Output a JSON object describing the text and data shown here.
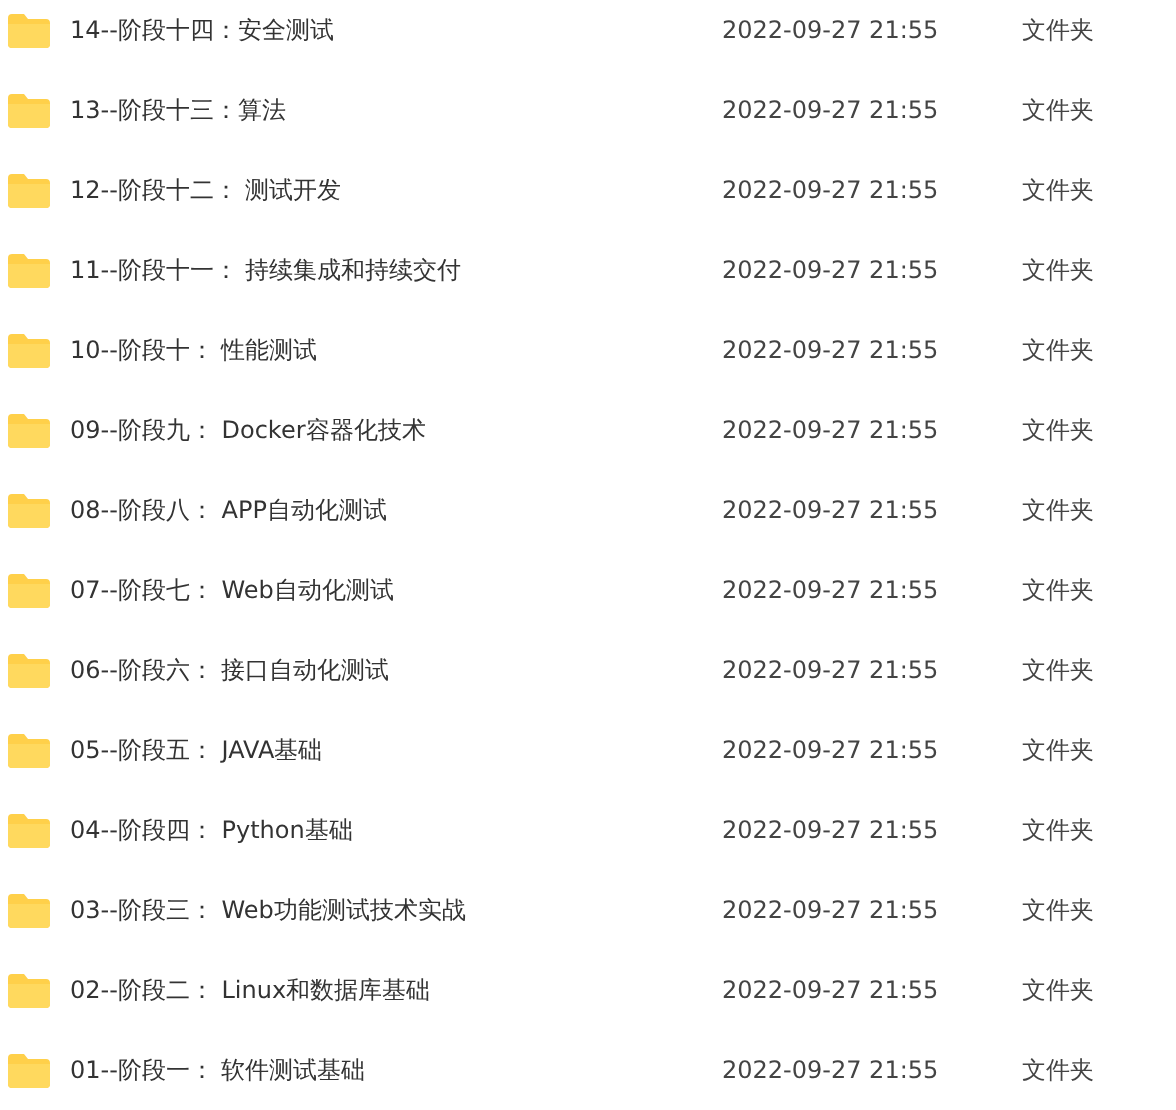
{
  "files": [
    {
      "name": "14--阶段十四：安全测试",
      "modified": "2022-09-27 21:55",
      "type": "文件夹"
    },
    {
      "name": "13--阶段十三：算法",
      "modified": "2022-09-27 21:55",
      "type": "文件夹"
    },
    {
      "name": "12--阶段十二： 测试开发",
      "modified": "2022-09-27 21:55",
      "type": "文件夹"
    },
    {
      "name": "11--阶段十一： 持续集成和持续交付",
      "modified": "2022-09-27 21:55",
      "type": "文件夹"
    },
    {
      "name": "10--阶段十： 性能测试",
      "modified": "2022-09-27 21:55",
      "type": "文件夹"
    },
    {
      "name": "09--阶段九： Docker容器化技术",
      "modified": "2022-09-27 21:55",
      "type": "文件夹"
    },
    {
      "name": "08--阶段八： APP自动化测试",
      "modified": "2022-09-27 21:55",
      "type": "文件夹"
    },
    {
      "name": "07--阶段七： Web自动化测试",
      "modified": "2022-09-27 21:55",
      "type": "文件夹"
    },
    {
      "name": "06--阶段六： 接口自动化测试",
      "modified": "2022-09-27 21:55",
      "type": "文件夹"
    },
    {
      "name": "05--阶段五： JAVA基础",
      "modified": "2022-09-27 21:55",
      "type": "文件夹"
    },
    {
      "name": "04--阶段四： Python基础",
      "modified": "2022-09-27 21:55",
      "type": "文件夹"
    },
    {
      "name": "03--阶段三： Web功能测试技术实战",
      "modified": "2022-09-27 21:55",
      "type": "文件夹"
    },
    {
      "name": "02--阶段二： Linux和数据库基础",
      "modified": "2022-09-27 21:55",
      "type": "文件夹"
    },
    {
      "name": "01--阶段一： 软件测试基础",
      "modified": "2022-09-27 21:55",
      "type": "文件夹"
    }
  ]
}
